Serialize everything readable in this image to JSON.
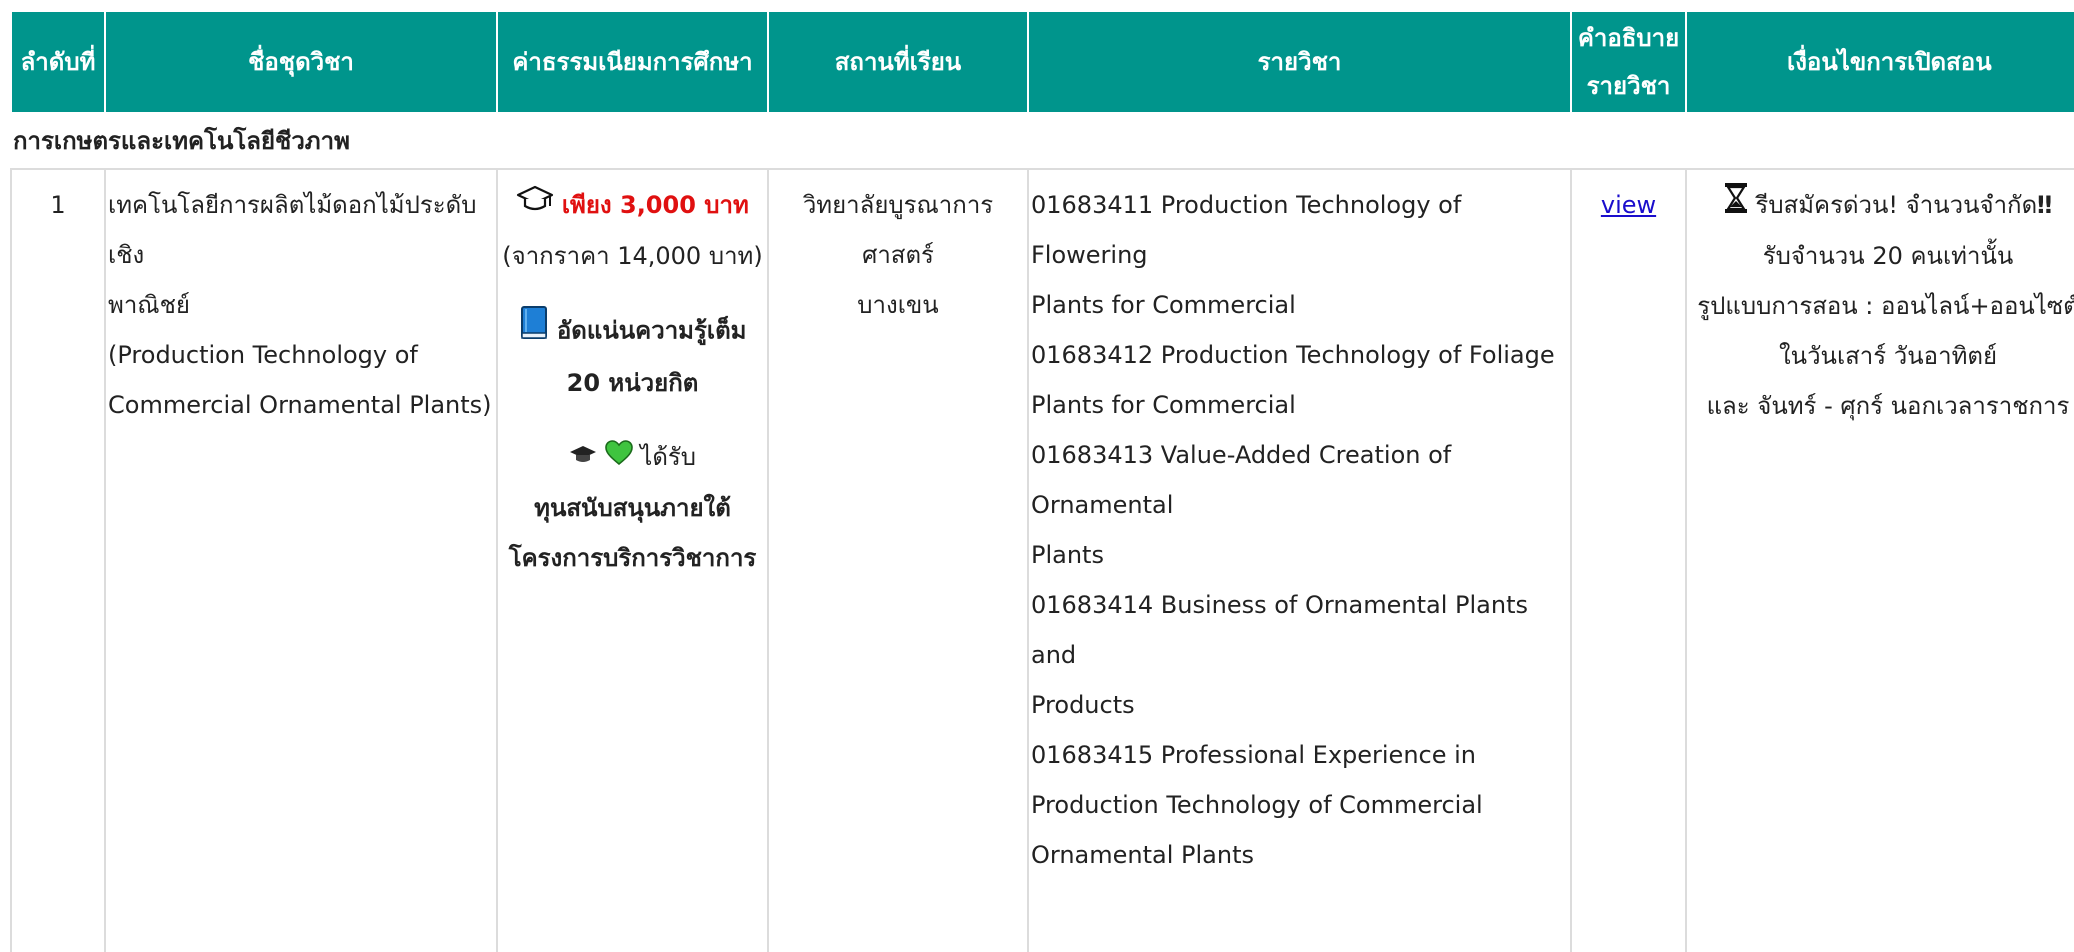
{
  "headers": {
    "no": "ลำดับที่",
    "course_set": "ชื่อชุดวิชา",
    "fee": "ค่าธรรมเนียมการศึกษา",
    "location": "สถานที่เรียน",
    "subjects": "รายวิชา",
    "description_line1": "คำอธิบาย",
    "description_line2": "รายวิชา",
    "conditions": "เงื่อนไขการเปิดสอน"
  },
  "group_title": "การเกษตรและเทคโนโลยีชีวภาพ",
  "row": {
    "no": "1",
    "course_set_th_1": "เทคโนโลยีการผลิตไม้ดอกไม้ประดับเชิง",
    "course_set_th_2": "พาณิชย์",
    "course_set_en_1": "(Production Technology of",
    "course_set_en_2": "Commercial Ornamental Plants)",
    "fee_price": "เพียง 3,000 บาท",
    "fee_original": "(จากราคา 14,000 บาท)",
    "fee_credits_1": "อัดแน่นความรู้เต็ม",
    "fee_credits_2": "20 หน่วยกิต",
    "fee_scholarship_1": "ได้รับ",
    "fee_scholarship_2": "ทุนสนับสนุนภายใต้",
    "fee_scholarship_3": "โครงการบริการวิชาการ",
    "location_1": "วิทยาลัยบูรณาการศาสตร์",
    "location_2": "บางเขน",
    "subject_lines": [
      "01683411 Production Technology of Flowering",
      "Plants for Commercial",
      "01683412 Production Technology of Foliage",
      "Plants for Commercial",
      "01683413 Value-Added Creation of Ornamental",
      "Plants",
      "01683414 Business of Ornamental Plants and",
      "Products",
      "01683415 Professional Experience in",
      "Production Technology of Commercial",
      "Ornamental Plants"
    ],
    "view_link": "view",
    "cond_1": "รีบสมัครด่วน! จำนวนจำกัด",
    "cond_1_mark": "‼",
    "cond_2": "รับจำนวน 20 คนเท่านั้น",
    "cond_3": "รูปแบบการสอน : ออนไลน์+ออนไซต์",
    "cond_4": "ในวันเสาร์ วันอาทิตย์",
    "cond_5": "และ จันทร์ - ศุกร์ นอกเวลาราชการ"
  },
  "icons": {
    "graduation": "graduation-cap-icon",
    "book": "blue-book-icon",
    "heart": "green-heart-icon",
    "hourglass": "hourglass-icon"
  },
  "colors": {
    "header_bg": "#00958c",
    "price_red": "#e01010",
    "link_blue": "#1a0dcc",
    "heart_green": "#3fc43f",
    "book_blue": "#1e7fd6"
  }
}
